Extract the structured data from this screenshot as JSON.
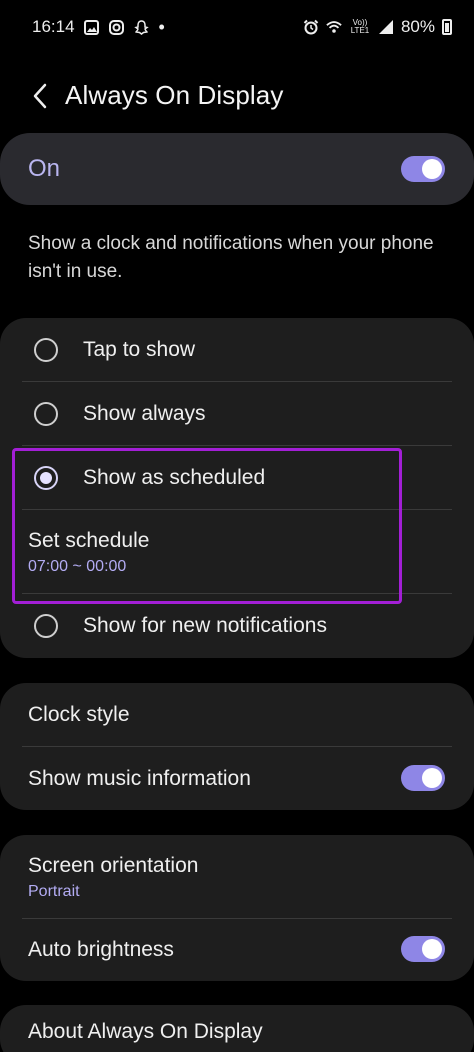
{
  "status_bar": {
    "time": "16:14",
    "network": "Vo)) LTE1",
    "battery": "80%"
  },
  "header": {
    "title": "Always On Display"
  },
  "master": {
    "label": "On",
    "enabled": true
  },
  "description": "Show a clock and notifications when your phone isn't in use.",
  "display_mode": {
    "options": [
      {
        "label": "Tap to show",
        "selected": false
      },
      {
        "label": "Show always",
        "selected": false
      },
      {
        "label": "Show as scheduled",
        "selected": true
      },
      {
        "label": "Show for new notifications",
        "selected": false
      }
    ],
    "schedule": {
      "label": "Set schedule",
      "value": "07:00 ~ 00:00"
    }
  },
  "clock_group": {
    "clock_style": "Clock style",
    "show_music": "Show music information",
    "show_music_enabled": true
  },
  "orientation_group": {
    "screen_orientation": "Screen orientation",
    "orientation_value": "Portrait",
    "auto_brightness": "Auto brightness",
    "auto_brightness_enabled": true
  },
  "about": {
    "label": "About Always On Display"
  },
  "colors": {
    "accent": "#8e86e6",
    "highlight": "#a31fd6",
    "card": "#1e1e1e"
  }
}
